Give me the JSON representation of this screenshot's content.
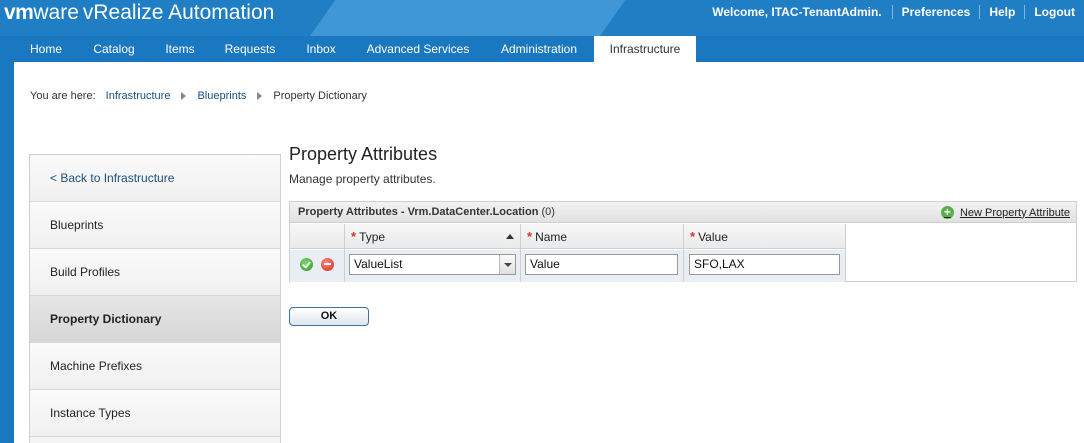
{
  "header": {
    "brand_vm": "vm",
    "brand_ware": "ware",
    "product": "vRealize Automation",
    "welcome": "Welcome, ITAC-TenantAdmin.",
    "preferences": "Preferences",
    "help": "Help",
    "logout": "Logout"
  },
  "nav": {
    "tabs": [
      "Home",
      "Catalog",
      "Items",
      "Requests",
      "Inbox",
      "Advanced Services",
      "Administration",
      "Infrastructure"
    ],
    "active": "Infrastructure"
  },
  "breadcrumb": {
    "prefix": "You are here:",
    "items": [
      "Infrastructure",
      "Blueprints",
      "Property Dictionary"
    ]
  },
  "sidebar": {
    "items": [
      "< Back to Infrastructure",
      "Blueprints",
      "Build Profiles",
      "Property Dictionary",
      "Machine Prefixes",
      "Instance Types"
    ],
    "active": "Property Dictionary"
  },
  "main": {
    "title": "Property Attributes",
    "subtitle": "Manage property attributes.",
    "grid": {
      "title": "Property Attributes - Vrm.DataCenter.Location",
      "count": "(0)",
      "new_label": "New Property Attribute",
      "columns": [
        "Type",
        "Name",
        "Value"
      ],
      "row": {
        "type": "ValueList",
        "name": "Value",
        "value": "SFO,LAX"
      }
    },
    "ok_label": "OK"
  },
  "colors": {
    "header_blue": "#1f7ec4",
    "required_star": "#d9342b",
    "link": "#1a4f80"
  }
}
